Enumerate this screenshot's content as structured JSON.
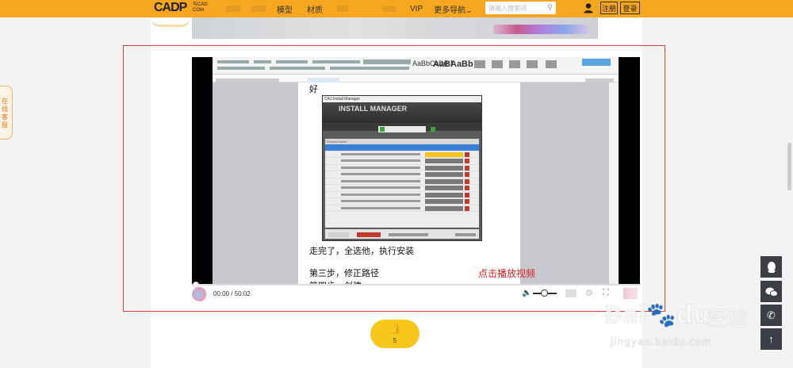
{
  "header": {
    "logo_text": "CADP",
    "logo_sub_top": "与CAD",
    "logo_sub_bottom": "COM",
    "nav": [
      {
        "label": ""
      },
      {
        "label": ""
      },
      {
        "label": "模型"
      },
      {
        "label": "材质"
      },
      {
        "label": ""
      },
      {
        "label": ""
      },
      {
        "label": "VIP"
      },
      {
        "label": "更多导航"
      }
    ],
    "search_placeholder": "请输入搜索词",
    "register": "注册",
    "login": "登录"
  },
  "video": {
    "current_time": "00:00",
    "separator": "/",
    "total_time": "50:02",
    "play_hint": "点击播放视频",
    "progress": 0.0,
    "volume": 0.5,
    "doc_lines": {
      "top_char": "好",
      "step_done": "走完了，全选他，执行安装",
      "step_three": "第三步，修正路径",
      "step_partial": "第四步，创建"
    },
    "installer": {
      "title": "CAJ Install Manager",
      "banner": "INSTALL MANAGER",
      "tab_ready": "Ready to Install",
      "tab_installed": "Installed",
      "col_product": "Product Name",
      "col_status": "Status",
      "sort_label": "Sort Order: Name A to Z",
      "clear_button": "Clear Queue",
      "delete_label": "Delete Package Once Installed",
      "details_label": "Show Details",
      "rows": [
        "Genesis 3 Male 3D Print Your Stuff",
        "Genesis 3 Male Starter Essentials",
        "Genesis 3 Male Starter Essentials",
        "Genesis 3 Female Starter Essentials",
        "Genesis 3 Male Starter Essentials",
        "Genesis 3 Male Starter Essentials",
        "Genesis 3 Female PowerPose 2D Handles",
        "Genesis 3 Female Starter Essentials",
        "Genesis 3 Starter Essentials"
      ]
    }
  },
  "like": {
    "count": "5"
  },
  "side_service": {
    "label": "在线客服"
  },
  "watermark": {
    "logo": "Bai",
    "paw": "du",
    "cn": "经验",
    "url": "jingyan.baidu.com"
  },
  "colors": {
    "topbar": "#f6a71f",
    "outline": "#d94040",
    "play_hint": "#d42121",
    "like_bg": "#f7c71c",
    "float_bg": "#3b3e44"
  },
  "icons": {
    "user": "user-icon",
    "search": "search-icon",
    "thumbs_up": "thumbs-up-icon",
    "volume": "volume-icon",
    "fullscreen": "fullscreen-icon",
    "settings": "settings-icon",
    "qq": "qq-icon",
    "wechat": "wechat-icon",
    "phone": "phone-icon",
    "to_top": "arrow-up-icon"
  }
}
